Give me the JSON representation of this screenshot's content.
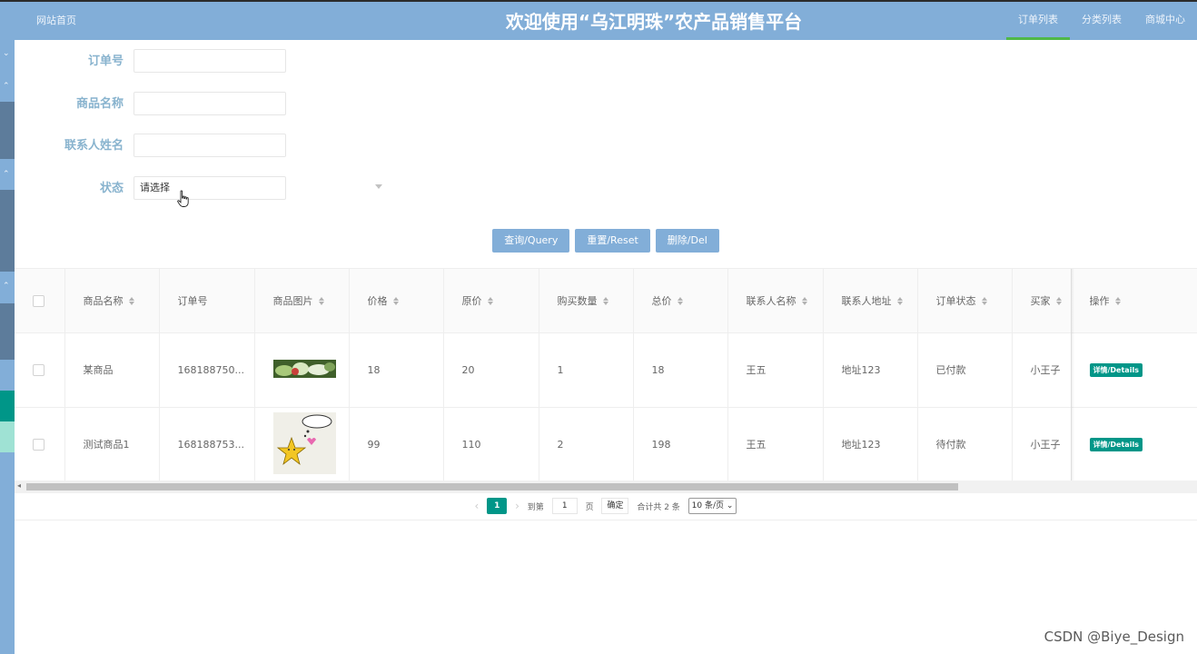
{
  "header": {
    "home_link": "网站首页",
    "title": "欢迎使用“乌江明珠”农产品销售平台",
    "nav": [
      {
        "label": "订单列表",
        "active": true
      },
      {
        "label": "分类列表",
        "active": false
      },
      {
        "label": "商城中心",
        "active": false
      }
    ]
  },
  "search": {
    "order_no": {
      "label": "订单号",
      "value": ""
    },
    "product_name": {
      "label": "商品名称",
      "value": ""
    },
    "contact_name": {
      "label": "联系人姓名",
      "value": ""
    },
    "status": {
      "label": "状态",
      "selected": "请选择"
    }
  },
  "actions": {
    "query": "查询/Query",
    "reset": "重置/Reset",
    "delete": "删除/Del"
  },
  "table": {
    "columns": [
      "商品名称",
      "订单号",
      "商品图片",
      "价格",
      "原价",
      "购买数量",
      "总价",
      "联系人名称",
      "联系人地址",
      "订单状态",
      "买家",
      "操作"
    ],
    "rows": [
      {
        "name": "某商品",
        "order_no": "168188750...",
        "price": "18",
        "orig_price": "20",
        "qty": "1",
        "total": "18",
        "contact": "王五",
        "address": "地址123",
        "status": "已付款",
        "buyer": "小王子",
        "action": "详情/Details"
      },
      {
        "name": "测试商品1",
        "order_no": "168188753...",
        "price": "99",
        "orig_price": "110",
        "qty": "2",
        "total": "198",
        "contact": "王五",
        "address": "地址123",
        "status": "待付款",
        "buyer": "小王子",
        "action": "详情/Details"
      }
    ]
  },
  "pagination": {
    "current": "1",
    "goto_label": "到第",
    "goto_value": "1",
    "page_label": "页",
    "confirm": "确定",
    "total": "合计共 2 条",
    "page_size": "10 条/页"
  },
  "watermark": "CSDN @Biye_Design",
  "colors": {
    "primary": "#82aed8",
    "accent": "#009688",
    "label": "#88b3ce"
  }
}
